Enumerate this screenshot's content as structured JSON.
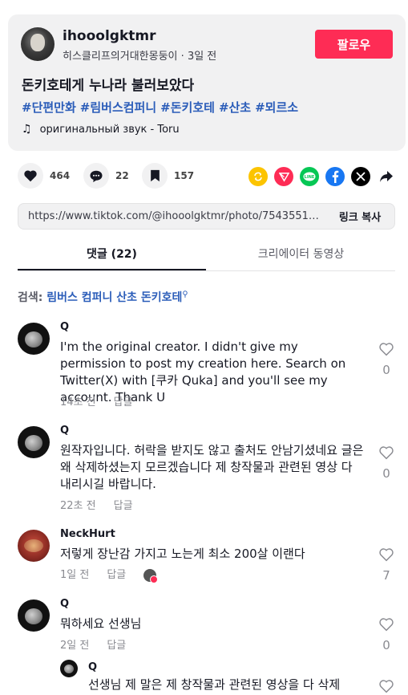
{
  "author": {
    "username": "ihooolgktmr",
    "nickname": "히스클리프의거대한몽둥이",
    "separator": " · ",
    "posted": "3일 전",
    "follow_label": "팔로우"
  },
  "post": {
    "title": "돈키호테게 누나라 불러보았다",
    "hashtags": [
      "#단편만화",
      "#림버스컴퍼니",
      "#돈키호테",
      "#산초",
      "#뫼르소"
    ],
    "music": "оригинальный звук - Toru"
  },
  "actions": {
    "likes": "464",
    "comments": "22",
    "saves": "157"
  },
  "link": {
    "url": "https://www.tiktok.com/@ihooolgktmr/photo/75435511...",
    "copy_label": "링크 복사"
  },
  "tabs": {
    "comments": "댓글 (22)",
    "creator_videos": "크리에이터 동영상"
  },
  "search": {
    "prefix": "검색: ",
    "query": "림버스 컴퍼니 산초 돈키호테"
  },
  "reply_label": "답글",
  "comments": [
    {
      "name": "Q",
      "text": "I'm the original creator. I didn't give my permission to post my creation here. Search on Twitter(X) with [쿠카 Quka] and you'll see my account. Thank U",
      "time": "14초 전",
      "likes": "0"
    },
    {
      "name": "Q",
      "text": "원작자입니다. 허락을 받지도 않고 출처도 안남기셨네요 글은 왜 삭제하셨는지 모르겠습니다 제 창작물과 관련된 영상 다 내리시길 바랍니다.",
      "time": "22초 전",
      "likes": "0"
    },
    {
      "name": "NeckHurt",
      "text": "저렇게 장난감 가지고 노는게 최소 200살 이랜다",
      "time": "1일 전",
      "likes": "7"
    },
    {
      "name": "Q",
      "text": "뭐하세요 선생님",
      "time": "2일 전",
      "likes": "0"
    },
    {
      "name": "Q",
      "text": "선생님 제 말은 제 창작물과 관련된 영상을 다 삭제"
    }
  ],
  "colors": {
    "follow": "#fe2c55",
    "hashtag": "#2b5db9",
    "repost": "#fcc400",
    "direct": "#fe2c55",
    "line": "#06c755",
    "facebook": "#1877f2",
    "x": "#000000"
  }
}
